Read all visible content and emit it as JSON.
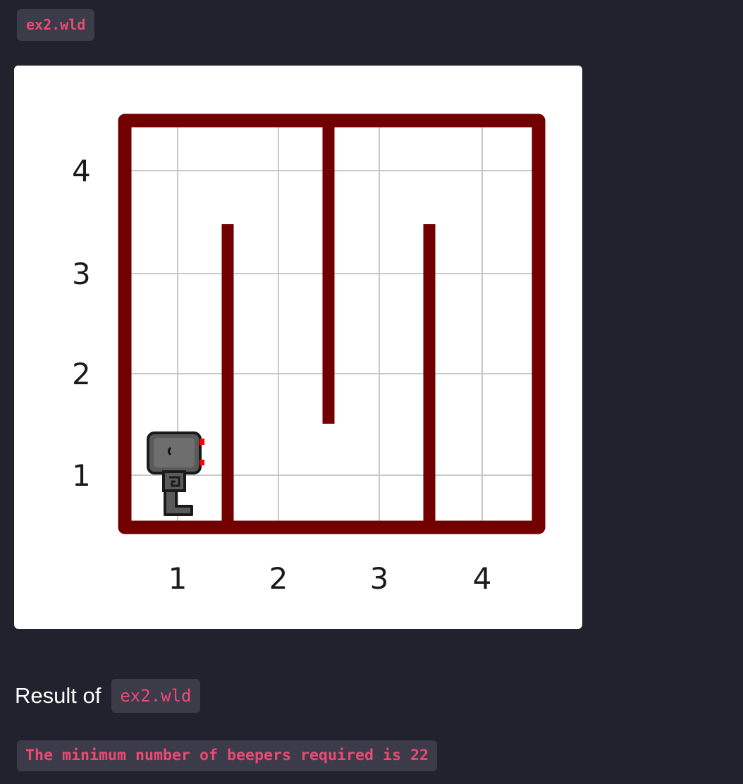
{
  "file": {
    "name": "ex2.wld"
  },
  "world": {
    "columns": 4,
    "rows": 4,
    "x_ticks": [
      "1",
      "2",
      "3",
      "4"
    ],
    "y_ticks": [
      "1",
      "2",
      "3",
      "4"
    ],
    "robot": {
      "street": 1,
      "avenue": 1
    },
    "walls": [
      {
        "between_avenues": [
          1,
          2
        ],
        "from_street": 1,
        "to_street": 3
      },
      {
        "between_avenues": [
          2,
          3
        ],
        "from_street": 2,
        "to_street": 4
      },
      {
        "between_avenues": [
          3,
          4
        ],
        "from_street": 1,
        "to_street": 3
      }
    ],
    "colors": {
      "wall": "#720000",
      "grid": "#c8c8c8",
      "robot_body": "#5a5a5a",
      "robot_led": "#ff0000"
    }
  },
  "result": {
    "heading": "Result of",
    "file_name": "ex2.wld",
    "output": "The minimum number of beepers required is 22"
  }
}
